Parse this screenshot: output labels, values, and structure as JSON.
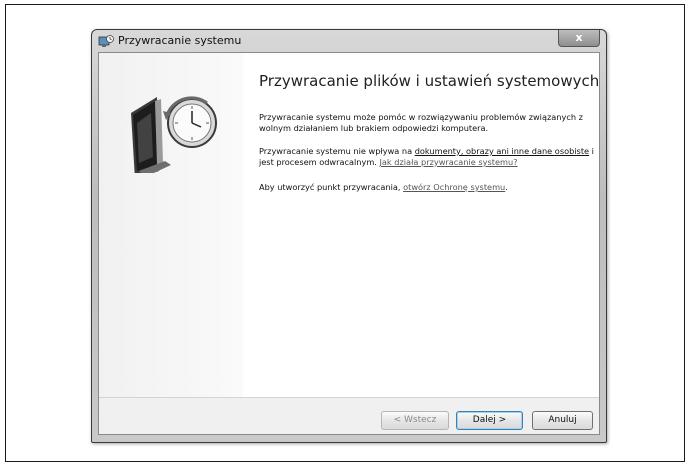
{
  "window": {
    "title": "Przywracanie systemu",
    "close_label": "x"
  },
  "content": {
    "heading": "Przywracanie plików i ustawień systemowych",
    "para1": "Przywracanie systemu może pomóc w rozwiązywaniu problemów związanych z wolnym działaniem lub brakiem odpowiedzi komputera.",
    "para2_text": "Przywracanie systemu nie wpływa na ",
    "para2_underlined": "dokumenty, obrazy ani inne dane osobiste",
    "para2_rest": " i jest procesem odwracalnym. ",
    "para2_link": "Jak działa przywracanie systemu?",
    "para3_text": "Aby utworzyć punkt przywracania, ",
    "para3_link": "otwórz Ochronę systemu",
    "para3_end": "."
  },
  "footer": {
    "back_label": "< Wstecz",
    "next_label": "Dalej >",
    "cancel_label": "Anuluj"
  },
  "icons": {
    "title": "system-restore-icon",
    "illustration": "monitor-clock-icon"
  }
}
